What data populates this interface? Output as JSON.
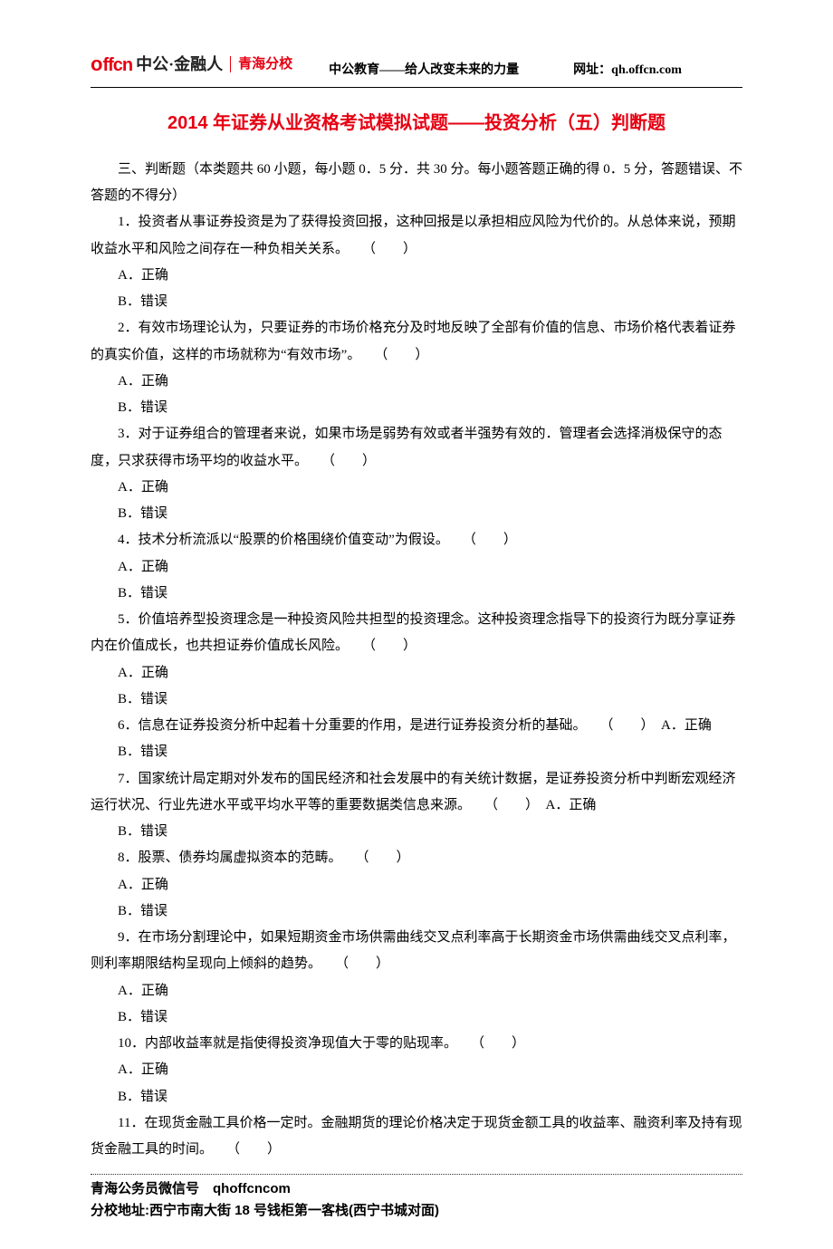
{
  "header": {
    "brand_offcn": "offcn",
    "brand_cn": "中公·金融人",
    "brand_branch": "青海分校",
    "slogan": "中公教育——给人改变未来的力量",
    "url_label": "网址：qh.offcn.com"
  },
  "title": "2014 年证券从业资格考试模拟试题——投资分析（五）判断题",
  "intro": "三、判断题（本类题共 60 小题，每小题 0．5 分．共 30 分。每小题答题正确的得 0．5 分，答题错误、不答题的不得分）",
  "questions": [
    {
      "text": "1．投资者从事证券投资是为了获得投资回报，这种回报是以承担相应风险为代价的。从总体来说，预期收益水平和风险之间存在一种负相关关系。　　（　　）",
      "a": "A．正确",
      "b": "B．错误"
    },
    {
      "text": "2．有效市场理论认为，只要证券的市场价格充分及时地反映了全部有价值的信息、市场价格代表着证券的真实价值，这样的市场就称为“有效市场”。　　（　　）",
      "a": "A．正确",
      "b": "B．错误"
    },
    {
      "text": "3．对于证券组合的管理者来说，如果市场是弱势有效或者半强势有效的．管理者会选择消极保守的态度，只求获得市场平均的收益水平。　　（　　）",
      "a": "A．正确",
      "b": "B．错误"
    },
    {
      "text": "4．技术分析流派以“股票的价格围绕价值变动”为假设。　　（　　）",
      "a": "A．正确",
      "b": "B．错误"
    },
    {
      "text": "5．价值培养型投资理念是一种投资风险共担型的投资理念。这种投资理念指导下的投资行为既分享证券内在价值成长，也共担证券价值成长风险。　　（　　）",
      "a": "A．正确",
      "b": "B．错误"
    },
    {
      "text": "6．信息在证券投资分析中起着十分重要的作用，是进行证券投资分析的基础。　　（　　）　A．正确",
      "a": "",
      "b": "B．错误"
    },
    {
      "text": "7．国家统计局定期对外发布的国民经济和社会发展中的有关统计数据，是证券投资分析中判断宏观经济运行状况、行业先进水平或平均水平等的重要数据类信息来源。　　（　　）　A．正确",
      "a": "",
      "b": "B．错误"
    },
    {
      "text": "8．股票、债券均属虚拟资本的范畴。　　（　　）",
      "a": "A．正确",
      "b": "B．错误"
    },
    {
      "text": "9．在市场分割理论中，如果短期资金市场供需曲线交叉点利率高于长期资金市场供需曲线交叉点利率，则利率期限结构呈现向上倾斜的趋势。　　（　　）",
      "a": "A．正确",
      "b": "B．错误"
    },
    {
      "text": "10．内部收益率就是指使得投资净现值大于零的贴现率。　　（　　）",
      "a": "A．正确",
      "b": "B．错误"
    },
    {
      "text": "11．在现货金融工具价格一定时。金融期货的理论价格决定于现货金额工具的收益率、融资利率及持有现货金融工具的时间。　　（　　）",
      "a": "",
      "b": ""
    }
  ],
  "footer": {
    "line1": "青海公务员微信号　qhoffcncom",
    "line2": "分校地址:西宁市南大街 18 号钱柜第一客栈(西宁书城对面)"
  }
}
